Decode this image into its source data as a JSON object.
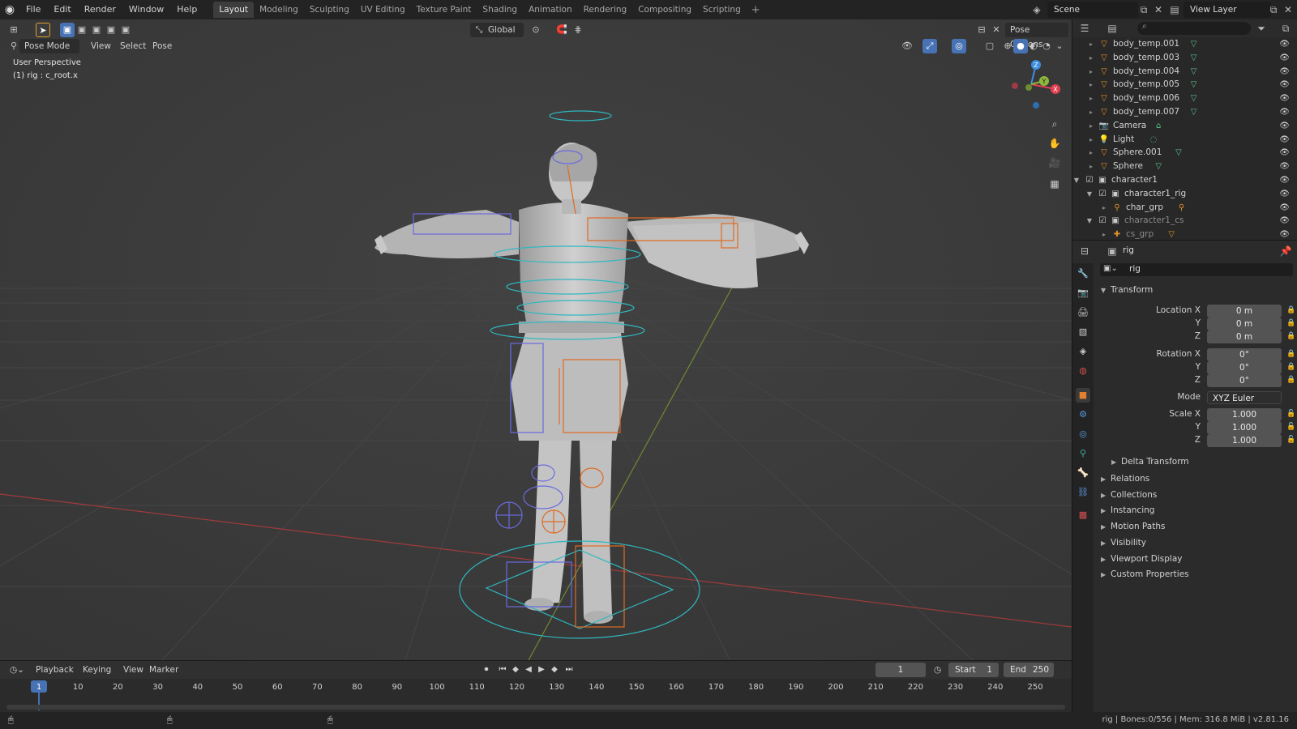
{
  "menu": {
    "items": [
      "File",
      "Edit",
      "Render",
      "Window",
      "Help"
    ]
  },
  "workspaces": {
    "tabs": [
      "Layout",
      "Modeling",
      "Sculpting",
      "UV Editing",
      "Texture Paint",
      "Shading",
      "Animation",
      "Rendering",
      "Compositing",
      "Scripting"
    ],
    "active": "Layout"
  },
  "scene": {
    "name": "Scene",
    "view_layer": "View Layer"
  },
  "viewport": {
    "mode": "Pose Mode",
    "menus": [
      "View",
      "Select",
      "Pose"
    ],
    "transform_orientation": "Global",
    "pose_options": "Pose Options",
    "perspective_label": "User Perspective",
    "active_label": "(1) rig : c_root.x",
    "gizmo": {
      "x": "X",
      "y": "Y",
      "z": "Z"
    }
  },
  "timeline": {
    "menus": [
      "Playback",
      "Keying",
      "View",
      "Marker"
    ],
    "current_frame": "1",
    "start_label": "Start",
    "start": "1",
    "end_label": "End",
    "end": "250",
    "ticks": [
      "1",
      "10",
      "20",
      "30",
      "40",
      "50",
      "60",
      "70",
      "80",
      "90",
      "100",
      "110",
      "120",
      "130",
      "140",
      "150",
      "160",
      "170",
      "180",
      "190",
      "200",
      "210",
      "220",
      "230",
      "240",
      "250"
    ]
  },
  "statusbar": {
    "text": "rig | Bones:0/556 | Mem: 316.8 MiB | v2.81.16"
  },
  "outliner": {
    "rows": [
      {
        "name": "body_temp.001",
        "type": "mesh",
        "indent": 1
      },
      {
        "name": "body_temp.003",
        "type": "mesh",
        "indent": 1
      },
      {
        "name": "body_temp.004",
        "type": "mesh",
        "indent": 1
      },
      {
        "name": "body_temp.005",
        "type": "mesh",
        "indent": 1
      },
      {
        "name": "body_temp.006",
        "type": "mesh",
        "indent": 1
      },
      {
        "name": "body_temp.007",
        "type": "mesh",
        "indent": 1
      },
      {
        "name": "Camera",
        "type": "camera",
        "indent": 1
      },
      {
        "name": "Light",
        "type": "light",
        "indent": 1
      },
      {
        "name": "Sphere.001",
        "type": "mesh",
        "indent": 1
      },
      {
        "name": "Sphere",
        "type": "mesh",
        "indent": 1
      },
      {
        "name": "character1",
        "type": "collection",
        "indent": 0
      },
      {
        "name": "character1_rig",
        "type": "collection",
        "indent": 1
      },
      {
        "name": "char_grp",
        "type": "armature",
        "indent": 2
      },
      {
        "name": "character1_cs",
        "type": "collection",
        "indent": 1
      },
      {
        "name": "cs_grp",
        "type": "empty",
        "indent": 2
      }
    ]
  },
  "properties": {
    "header_object": "rig",
    "object_name": "rig",
    "transform_title": "Transform",
    "location_label": "Location X",
    "rotation_label": "Rotation X",
    "scale_label": "Scale X",
    "axis_y": "Y",
    "axis_z": "Z",
    "location": [
      "0 m",
      "0 m",
      "0 m"
    ],
    "rotation": [
      "0°",
      "0°",
      "0°"
    ],
    "mode_label": "Mode",
    "mode": "XYZ Euler",
    "scale": [
      "1.000",
      "1.000",
      "1.000"
    ],
    "delta_transform": "Delta Transform",
    "sections": [
      "Relations",
      "Collections",
      "Instancing",
      "Motion Paths",
      "Visibility",
      "Viewport Display",
      "Custom Properties"
    ]
  },
  "colors": {
    "accent": "#4772b3",
    "x_axis": "#e04050",
    "y_axis": "#8db83c",
    "z_axis": "#3d8ee0",
    "cyan_control": "#2fb8c0",
    "orange_control": "#e06a20",
    "blue_control": "#6a6ae0"
  }
}
